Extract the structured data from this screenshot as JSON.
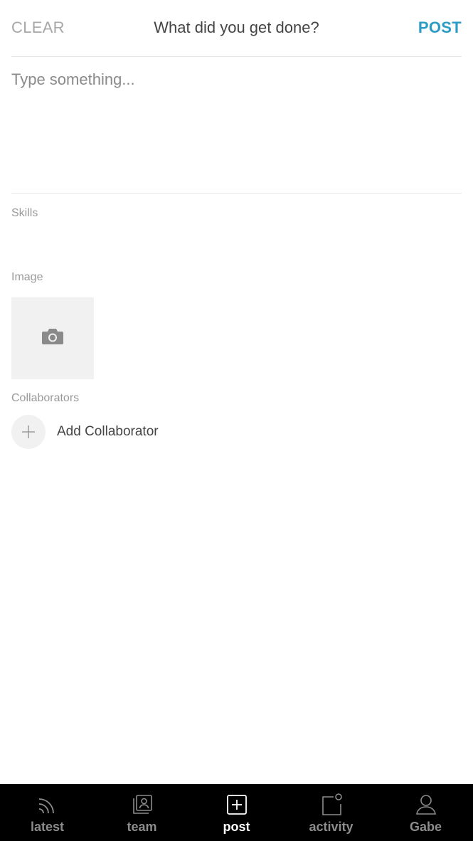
{
  "header": {
    "clear_label": "CLEAR",
    "title": "What did you get done?",
    "post_label": "POST"
  },
  "compose": {
    "placeholder": "Type something..."
  },
  "sections": {
    "skills_label": "Skills",
    "image_label": "Image",
    "collaborators_label": "Collaborators",
    "add_collaborator_label": "Add Collaborator"
  },
  "icons": {
    "camera": "camera-icon",
    "plus": "plus-icon"
  },
  "tabbar": {
    "active": "post",
    "tabs": [
      {
        "id": "latest",
        "label": "latest",
        "icon": "rss-icon"
      },
      {
        "id": "team",
        "label": "team",
        "icon": "team-icon"
      },
      {
        "id": "post",
        "label": "post",
        "icon": "plus-square-icon"
      },
      {
        "id": "activity",
        "label": "activity",
        "icon": "notification-icon"
      },
      {
        "id": "profile",
        "label": "Gabe",
        "icon": "user-icon"
      }
    ]
  },
  "colors": {
    "accent": "#2b9cc5",
    "tabbar_bg": "#000000",
    "tab_inactive": "#8c8c8c",
    "tab_active": "#ffffff"
  }
}
